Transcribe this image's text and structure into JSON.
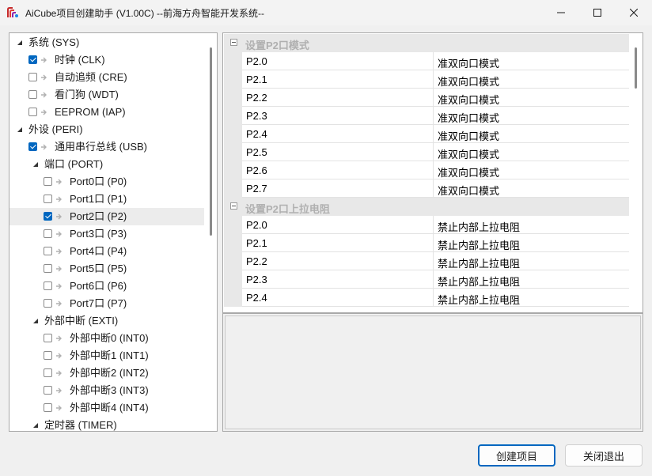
{
  "window": {
    "title": "AiCube项目创建助手 (V1.00C) --前海方舟智能开发系统--",
    "minimize_icon": "minimize-icon",
    "maximize_icon": "maximize-icon",
    "close_icon": "close-icon"
  },
  "tree": {
    "items": [
      {
        "label": "系统 (SYS)",
        "level": 0,
        "expanded": true,
        "checkbox": false
      },
      {
        "label": "时钟 (CLK)",
        "level": 1,
        "checkbox": true,
        "checked": true
      },
      {
        "label": "自动追频 (CRE)",
        "level": 1,
        "checkbox": true,
        "checked": false
      },
      {
        "label": "看门狗 (WDT)",
        "level": 1,
        "checkbox": true,
        "checked": false
      },
      {
        "label": "EEPROM (IAP)",
        "level": 1,
        "checkbox": true,
        "checked": false
      },
      {
        "label": "外设 (PERI)",
        "level": 0,
        "expanded": true,
        "checkbox": false
      },
      {
        "label": "通用串行总线 (USB)",
        "level": 1,
        "checkbox": true,
        "checked": true
      },
      {
        "label": "端口 (PORT)",
        "level": 1,
        "expanded": true,
        "checkbox": false
      },
      {
        "label": "Port0口 (P0)",
        "level": 2,
        "checkbox": true,
        "checked": false
      },
      {
        "label": "Port1口 (P1)",
        "level": 2,
        "checkbox": true,
        "checked": false
      },
      {
        "label": "Port2口 (P2)",
        "level": 2,
        "checkbox": true,
        "checked": true,
        "selected": true
      },
      {
        "label": "Port3口 (P3)",
        "level": 2,
        "checkbox": true,
        "checked": false
      },
      {
        "label": "Port4口 (P4)",
        "level": 2,
        "checkbox": true,
        "checked": false
      },
      {
        "label": "Port5口 (P5)",
        "level": 2,
        "checkbox": true,
        "checked": false
      },
      {
        "label": "Port6口 (P6)",
        "level": 2,
        "checkbox": true,
        "checked": false
      },
      {
        "label": "Port7口 (P7)",
        "level": 2,
        "checkbox": true,
        "checked": false
      },
      {
        "label": "外部中断 (EXTI)",
        "level": 1,
        "expanded": true,
        "checkbox": false
      },
      {
        "label": "外部中断0 (INT0)",
        "level": 2,
        "checkbox": true,
        "checked": false
      },
      {
        "label": "外部中断1 (INT1)",
        "level": 2,
        "checkbox": true,
        "checked": false
      },
      {
        "label": "外部中断2 (INT2)",
        "level": 2,
        "checkbox": true,
        "checked": false
      },
      {
        "label": "外部中断3 (INT3)",
        "level": 2,
        "checkbox": true,
        "checked": false
      },
      {
        "label": "外部中断4 (INT4)",
        "level": 2,
        "checkbox": true,
        "checked": false
      },
      {
        "label": "定时器 (TIMER)",
        "level": 1,
        "expanded": true,
        "checkbox": false
      }
    ]
  },
  "property_grid": {
    "categories": [
      {
        "label": "设置P2口模式",
        "rows": [
          {
            "name": "P2.0",
            "value": "准双向口模式"
          },
          {
            "name": "P2.1",
            "value": "准双向口模式"
          },
          {
            "name": "P2.2",
            "value": "准双向口模式"
          },
          {
            "name": "P2.3",
            "value": "准双向口模式"
          },
          {
            "name": "P2.4",
            "value": "准双向口模式"
          },
          {
            "name": "P2.5",
            "value": "准双向口模式"
          },
          {
            "name": "P2.6",
            "value": "准双向口模式"
          },
          {
            "name": "P2.7",
            "value": "准双向口模式"
          }
        ]
      },
      {
        "label": "设置P2口上拉电阻",
        "rows": [
          {
            "name": "P2.0",
            "value": "禁止内部上拉电阻"
          },
          {
            "name": "P2.1",
            "value": "禁止内部上拉电阻"
          },
          {
            "name": "P2.2",
            "value": "禁止内部上拉电阻"
          },
          {
            "name": "P2.3",
            "value": "禁止内部上拉电阻"
          },
          {
            "name": "P2.4",
            "value": "禁止内部上拉电阻"
          }
        ]
      }
    ]
  },
  "buttons": {
    "create_label": "创建项目",
    "close_label": "关闭退出"
  },
  "colors": {
    "accent": "#0067c0",
    "selection": "#ececec",
    "category_bg": "#e8e8e8"
  }
}
